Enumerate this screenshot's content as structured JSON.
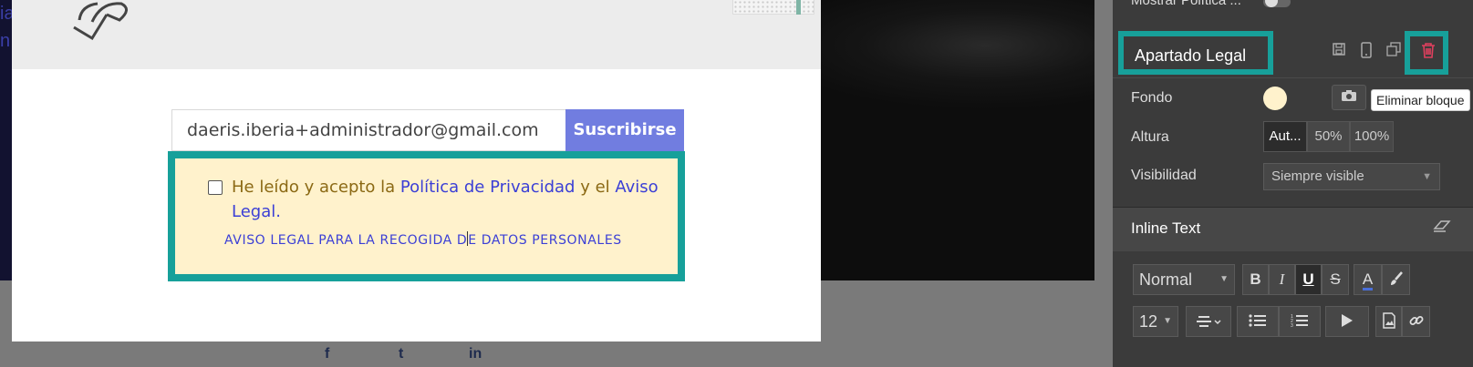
{
  "background": {
    "left_text": [
      "ia",
      "n"
    ]
  },
  "modal": {
    "email_value": "daeris.iberia+administrador@gmail.com",
    "subscribe_label": "Suscribirse",
    "legal_text_prefix": "He leído y acepto la ",
    "privacy_link": "Política de Privacidad",
    "legal_text_mid": " y el ",
    "aviso_link": "Aviso Legal",
    "legal_text_suffix": ".",
    "caps_before_cursor": "AVISO LEGAL PARA LA RECOGIDA D",
    "caps_after_cursor": "E DATOS PERSONALES",
    "accent_color": "#17a09a",
    "box_color": "#fff2cc",
    "button_color": "#717de0"
  },
  "social": [
    "f",
    "t",
    "in"
  ],
  "panel": {
    "mostrar_label": "Mostrar Política ...",
    "block_title": "Apartado Legal",
    "delete_tooltip": "Eliminar bloque",
    "fondo_label": "Fondo",
    "altura_label": "Altura",
    "altura_options": [
      "Aut...",
      "50%",
      "100%"
    ],
    "visibilidad_label": "Visibilidad",
    "visibilidad_value": "Siempre visible",
    "inline_title": "Inline Text",
    "style_value": "Normal",
    "size_value": "12",
    "icons": [
      "save-icon",
      "mobile-icon",
      "duplicate-icon",
      "trash-icon",
      "camera-icon",
      "eraser-icon",
      "bold-icon",
      "italic-icon",
      "underline-icon",
      "strikethrough-icon",
      "font-color-icon",
      "paintbrush-icon",
      "align-icon",
      "bulleted-list-icon",
      "numbered-list-icon",
      "play-icon",
      "image-icon",
      "link-icon"
    ]
  }
}
